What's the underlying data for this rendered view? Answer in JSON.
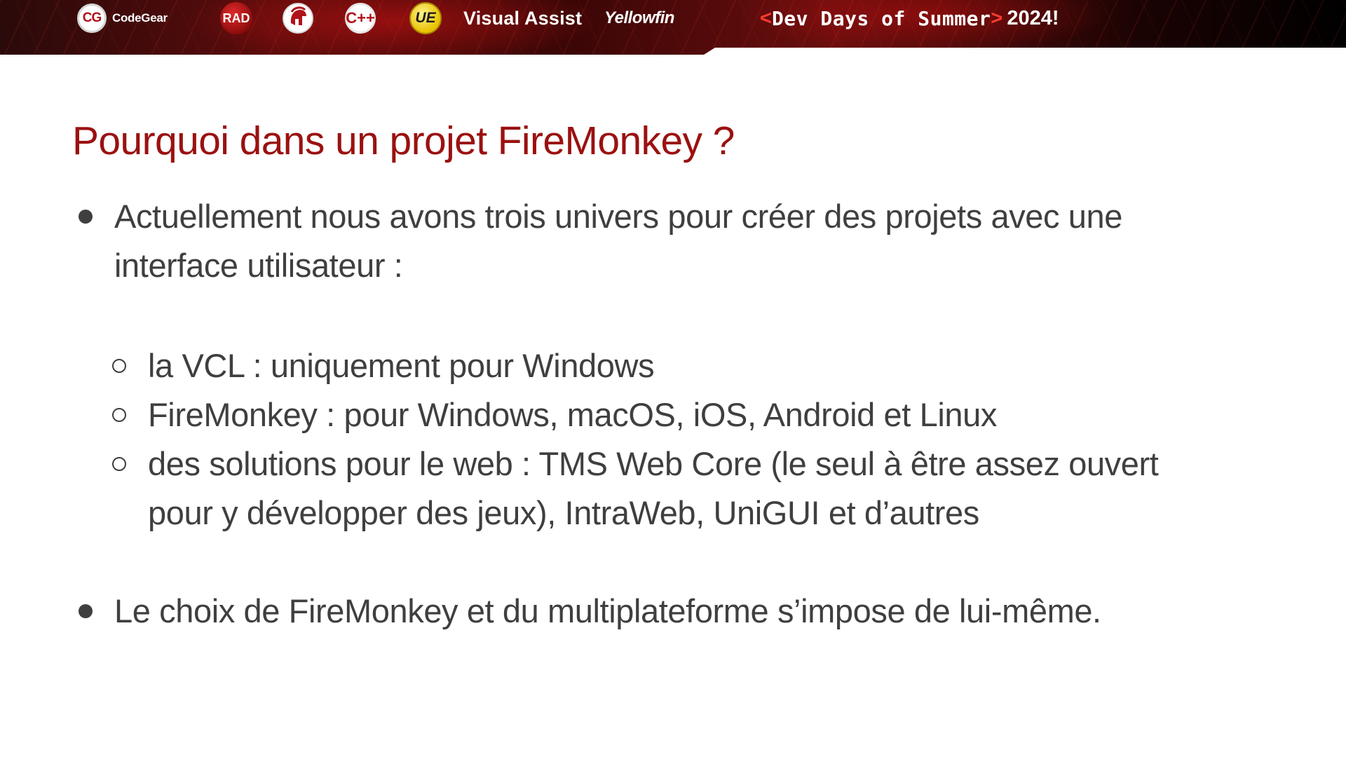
{
  "banner": {
    "logos": {
      "codegear_badge": "CG",
      "codegear_label": "CodeGear",
      "rad_badge": "RAD",
      "helmet_icon": "spartan-helmet-icon",
      "cpp_badge": "C++",
      "ue_badge": "UE",
      "visual_assist_label": "Visual Assist",
      "yellowfin_label": "Yellowfin"
    },
    "event": {
      "open_bracket": "<",
      "name": "Dev Days of Summer",
      "close_bracket": ">",
      "year": "2024!"
    },
    "colors": {
      "accent_red": "#ff3b30",
      "banner_dark": "#2a0a0a"
    }
  },
  "slide": {
    "title": "Pourquoi dans un projet FireMonkey ?",
    "title_color": "#9b1111",
    "text_color": "#3f3f3f",
    "bullets": [
      {
        "lines": [
          "Actuellement nous avons trois univers pour créer des projets avec une",
          "interface utilisateur :"
        ],
        "sub_items": [
          {
            "lines": [
              "la VCL : uniquement pour Windows"
            ]
          },
          {
            "lines": [
              "FireMonkey : pour Windows, macOS, iOS, Android et Linux"
            ]
          },
          {
            "lines": [
              "des solutions pour le web : TMS Web Core (le seul à être assez ouvert",
              "pour y développer des jeux), IntraWeb, UniGUI et d’autres"
            ]
          }
        ]
      },
      {
        "lines": [
          "Le choix de FireMonkey et du multiplateforme s’impose de lui-même."
        ],
        "sub_items": []
      }
    ]
  }
}
